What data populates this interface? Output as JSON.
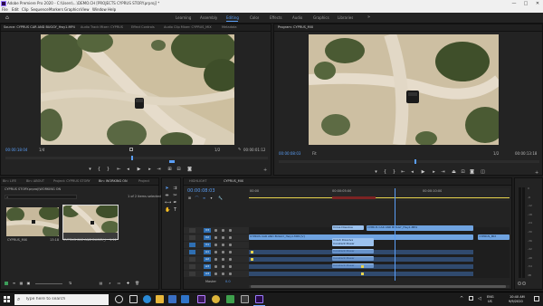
{
  "window": {
    "title": "Adobe Premiere Pro 2020 - C:\\Users\\...\\DEMO.CH [PROJECTS CYPRUS STORY.prproj] *",
    "controls": [
      "—",
      "□",
      "✕"
    ]
  },
  "menu": [
    "File",
    "Edit",
    "Clip",
    "Sequence",
    "Markers",
    "Graphics",
    "View",
    "Window",
    "Help"
  ],
  "workspaces": {
    "items": [
      "Learning",
      "Assembly",
      "Editing",
      "Color",
      "Effects",
      "Audio",
      "Graphics",
      "Libraries"
    ],
    "active_index": 2
  },
  "source_monitor": {
    "tabs": [
      "Source: CYPRUS CAR AND BUGGY_Hwy1.MP4",
      "Audio Track Mixer: CYPRUS",
      "Effect Controls",
      "Audio Clip Mixer: CYPRUS_MIX",
      "Metadata"
    ],
    "timecode": "00:00:18:04",
    "zoom": "1/4",
    "fraction": "1/2",
    "duration": "00:00:01:12",
    "playhead_fraction": 0.48
  },
  "program_monitor": {
    "tabs": [
      "Program: CYPRUS_MIX"
    ],
    "timecode": "00:00:08:03",
    "zoom": "Fit",
    "fraction": "1/2",
    "duration": "00:00:13:18",
    "playhead_fraction": 0.52
  },
  "project_panel": {
    "tabs": [
      "Bin: LIFE",
      "Bin: ABOUT",
      "Project: CYPRUS STORY",
      "Bin: WORKING ON",
      "Project"
    ],
    "active_tab": 3,
    "path": "CYPRUS STORY.prproj\\WORKING ON",
    "selection_info": "1 of 2 items selected",
    "items": [
      {
        "name": "CYPRUS_MIX",
        "duration": "13:18"
      },
      {
        "name": "CYPRUS CAR AND BUGGY_Hwy1.MP4",
        "duration": "1:12"
      }
    ]
  },
  "timeline": {
    "tabs": [
      "HIGHLIGHT",
      "CYPRUS_MIX"
    ],
    "active_tab": 1,
    "timecode": "00:00:08:03",
    "ruler_labels": [
      "00:00",
      "00:00:05:00",
      "00:00:10:00"
    ],
    "playhead_fraction": 0.56,
    "video_tracks": [
      "V3",
      "V2",
      "V1"
    ],
    "audio_tracks": [
      "A1",
      "A2",
      "A3",
      "A4"
    ],
    "master_label": "Master",
    "master_value": "0.0",
    "clips": [
      {
        "label": "Cross Dissolve",
        "track": 0,
        "start": 0.32,
        "end": 0.44,
        "kind": "lightblue"
      },
      {
        "label": "CYPRUS CAR AND BUGGY_Hwy1.MP4",
        "track": 0,
        "start": 0.45,
        "end": 0.86,
        "kind": "blue"
      },
      {
        "label": "CYPRUS CAR AND BUGGY_Hwy1.MP4 [V]",
        "track": 1,
        "start": 0.0,
        "end": 0.86,
        "kind": "blue"
      },
      {
        "label": "CYPRUS_MIX",
        "track": 1,
        "start": 0.88,
        "end": 1.0,
        "kind": "blue"
      },
      {
        "label": "Crash Dissolve",
        "track": 1.5,
        "start": 0.32,
        "end": 0.48,
        "kind": "lightblue"
      },
      {
        "label": "Constant Power",
        "track": 2,
        "start": 0.32,
        "end": 0.48,
        "kind": "lightblue"
      },
      {
        "label": "Constant Power",
        "track": 3,
        "start": 0.32,
        "end": 0.48,
        "kind": "lightblue"
      },
      {
        "label": "Constant Power",
        "track": 4,
        "start": 0.32,
        "end": 0.48,
        "kind": "lightblue"
      },
      {
        "label": "Constant Power",
        "track": 5,
        "start": 0.32,
        "end": 0.48,
        "kind": "lightblue"
      }
    ]
  },
  "audio_meter_labels": [
    "0",
    "-6",
    "-12",
    "-18",
    "-24",
    "-30",
    "-36",
    "-42",
    "-48",
    "-54",
    "dB"
  ],
  "taskbar": {
    "search_placeholder": "Type here to search",
    "lang": "ENG",
    "region": "US",
    "time": "10:40 AM",
    "date": "9/9/2020"
  }
}
